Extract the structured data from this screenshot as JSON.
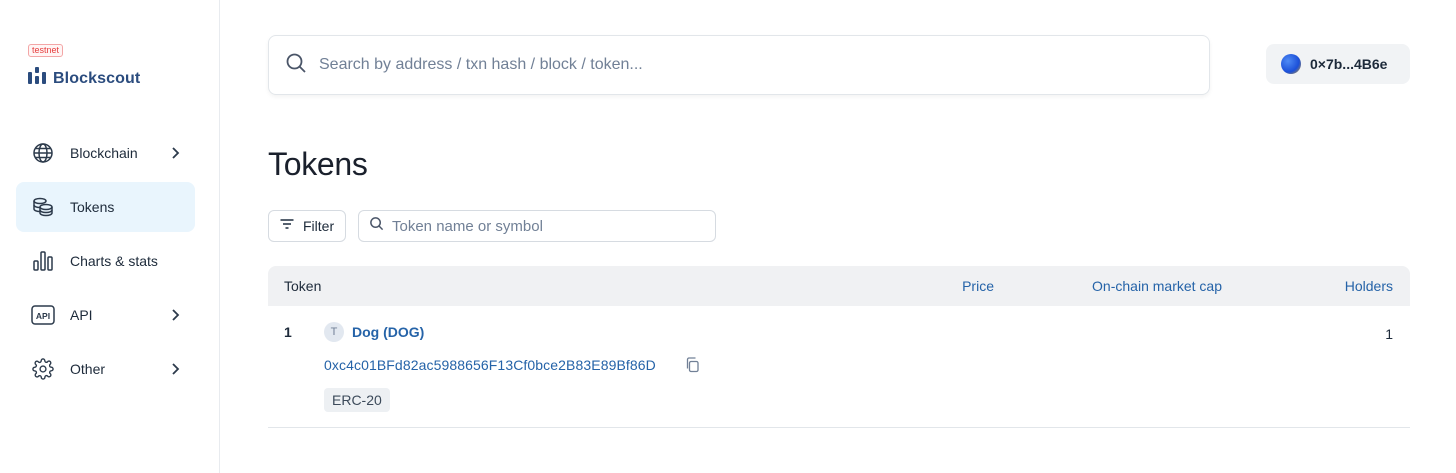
{
  "sidebar": {
    "badge": "testnet",
    "logo_text": "Blockscout",
    "items": [
      {
        "label": "Blockchain",
        "icon": "globe-icon",
        "has_chevron": true,
        "active": false
      },
      {
        "label": "Tokens",
        "icon": "coins-icon",
        "has_chevron": false,
        "active": true
      },
      {
        "label": "Charts & stats",
        "icon": "bar-chart-icon",
        "has_chevron": false,
        "active": false
      },
      {
        "label": "API",
        "icon": "api-icon",
        "has_chevron": true,
        "active": false
      },
      {
        "label": "Other",
        "icon": "gear-icon",
        "has_chevron": true,
        "active": false
      }
    ]
  },
  "header": {
    "search_placeholder": "Search by address / txn hash / block / token...",
    "wallet_label": "0×7b...4B6e"
  },
  "main": {
    "title": "Tokens",
    "filter_label": "Filter",
    "token_search_placeholder": "Token name or symbol",
    "table": {
      "headers": {
        "token": "Token",
        "price": "Price",
        "market_cap": "On-chain market cap",
        "holders": "Holders"
      },
      "rows": [
        {
          "index": "1",
          "avatar_letter": "T",
          "name": "Dog (DOG)",
          "address": "0xc4c01BFd82ac5988656F13Cf0bce2B83E89Bf86D",
          "type": "ERC-20",
          "holders": "1"
        }
      ]
    }
  },
  "colors": {
    "link": "#2563a8",
    "active_nav_bg": "#e9f5fd",
    "header_bg": "#f0f1f3",
    "testnet": "#e53e3e"
  }
}
